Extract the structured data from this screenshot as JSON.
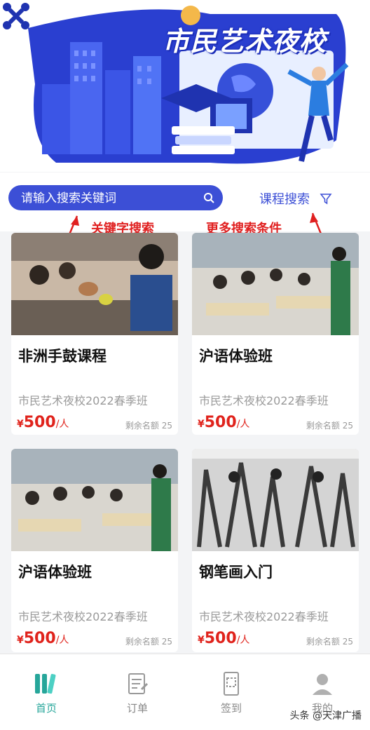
{
  "banner": {
    "title": "市民艺术夜校"
  },
  "search": {
    "placeholder": "请输入搜索关键词",
    "course_search_label": "课程搜索"
  },
  "annotations": {
    "keyword": "关键字搜索",
    "more_conditions": "更多搜索条件"
  },
  "courses": [
    {
      "title": "非洲手鼓课程",
      "subtitle": "市民艺术夜校2022春季班",
      "currency": "¥",
      "price": "500",
      "unit": "/人",
      "remaining": "剩余名额 25"
    },
    {
      "title": "沪语体验班",
      "subtitle": "市民艺术夜校2022春季班",
      "currency": "¥",
      "price": "500",
      "unit": "/人",
      "remaining": "剩余名额 25"
    },
    {
      "title": "沪语体验班",
      "subtitle": "市民艺术夜校2022春季班",
      "currency": "¥",
      "price": "500",
      "unit": "/人",
      "remaining": "剩余名额 25"
    },
    {
      "title": "钢笔画入门",
      "subtitle": "市民艺术夜校2022春季班",
      "currency": "¥",
      "price": "500",
      "unit": "/人",
      "remaining": "剩余名额 25"
    }
  ],
  "tabbar": {
    "items": [
      {
        "label": "首页",
        "icon": "home-books-icon",
        "active": true
      },
      {
        "label": "订单",
        "icon": "order-icon",
        "active": false
      },
      {
        "label": "签到",
        "icon": "checkin-icon",
        "active": false
      },
      {
        "label": "我的",
        "icon": "profile-icon",
        "active": false
      }
    ]
  },
  "watermark": "头条 @天津广播",
  "colors": {
    "primary": "#3c4fd6",
    "price": "#e0231c",
    "active_tab": "#26a69a",
    "annotation": "#e02020"
  }
}
